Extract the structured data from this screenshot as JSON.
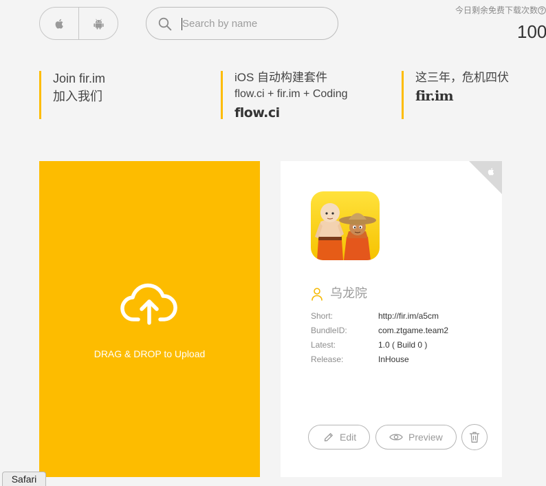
{
  "platform_toggle": {
    "ios_icon": "apple-icon",
    "android_icon": "android-icon"
  },
  "search": {
    "placeholder": "Search by name",
    "icon": "search-icon"
  },
  "quota": {
    "label": "今日剩余免费下载次数",
    "help_icon": "question-circle-icon",
    "count": "100"
  },
  "banners": [
    {
      "title": "Join fir.im",
      "subtitle": "加入我们"
    },
    {
      "title": "iOS 自动构建套件",
      "subtitle": "flow.ci + fir.im + Coding",
      "logo": "flow.ci"
    },
    {
      "title": "这三年，危机四伏",
      "logo": "fir.im"
    }
  ],
  "upload": {
    "icon": "cloud-upload-icon",
    "label": "DRAG & DROP to Upload"
  },
  "app": {
    "platform_icon": "apple-icon",
    "owner_icon": "user-icon",
    "name": "乌龙院",
    "details": [
      {
        "label": "Short:",
        "value": "http://fir.im/a5cm"
      },
      {
        "label": "BundleID:",
        "value": "com.ztgame.team2"
      },
      {
        "label": "Latest:",
        "value": "1.0 ( Build 0 )"
      },
      {
        "label": "Release:",
        "value": "InHouse"
      }
    ],
    "actions": {
      "edit": {
        "icon": "pencil-icon",
        "label": "Edit"
      },
      "preview": {
        "icon": "eye-icon",
        "label": "Preview"
      },
      "delete": {
        "icon": "trash-icon"
      }
    }
  },
  "dock_tooltip": {
    "label": "Safari"
  },
  "colors": {
    "accent": "#FDBC00",
    "page_background": "#F4F4F4",
    "card_background": "#FFFFFF",
    "corner_badge": "#D9D9D9",
    "muted_text": "#999999"
  }
}
